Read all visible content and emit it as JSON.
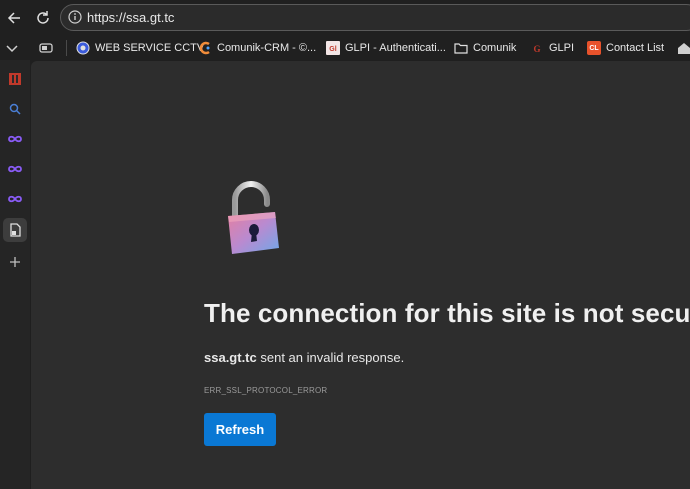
{
  "browser": {
    "url": "https://ssa.gt.tc"
  },
  "bookmarks": [
    {
      "label": "WEB SERVICE CCTV",
      "icon": "globe-icon"
    },
    {
      "label": "Comunik-CRM - ©...",
      "icon": "crm-logo-icon"
    },
    {
      "label": "GLPI - Authenticati...",
      "icon": "glpi-icon"
    },
    {
      "label": "Comunik",
      "icon": "folder-icon"
    },
    {
      "label": "GLPI",
      "icon": "glpi-icon"
    },
    {
      "label": "Contact List",
      "icon": "cl-icon",
      "icon_text": "CL"
    }
  ],
  "page": {
    "title": "The connection for this site is not secure",
    "host": "ssa.gt.tc",
    "message": " sent an invalid response.",
    "error_code": "ERR_SSL_PROTOCOL_ERROR",
    "refresh_label": "Refresh"
  },
  "colors": {
    "accent": "#0a78d4",
    "background": "#2d2d2d"
  }
}
